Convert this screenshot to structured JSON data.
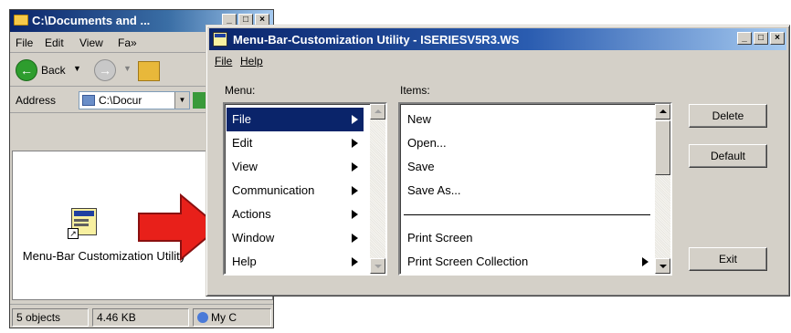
{
  "explorer": {
    "title": "C:\\Documents and ...",
    "menu": [
      "File",
      "Edit",
      "View",
      "Fa»"
    ],
    "back_label": "Back",
    "address_label": "Address",
    "address_value": "C:\\Docur",
    "file_icon_label": "Menu-Bar Customization Utility",
    "status": {
      "objects": "5 objects",
      "size": "4.46 KB",
      "zone": "My C"
    }
  },
  "dialog": {
    "title": "Menu-Bar-Customization Utility - ISERIESV5R3.WS",
    "menubar": [
      "File",
      "Help"
    ],
    "menu_label": "Menu:",
    "items_label": "Items:",
    "menu_items": [
      "File",
      "Edit",
      "View",
      "Communication",
      "Actions",
      "Window",
      "Help"
    ],
    "selected_menu_index": 0,
    "items": [
      "New",
      "Open...",
      "Save",
      "Save As...",
      "",
      "Print Screen",
      "Print Screen Collection"
    ],
    "buttons": {
      "delete": "Delete",
      "default": "Default",
      "exit": "Exit"
    }
  },
  "colors": {
    "selection": "#0a246a",
    "title_bar": "#0a246a",
    "arrow": "#e8201a",
    "face": "#d4d0c8"
  }
}
